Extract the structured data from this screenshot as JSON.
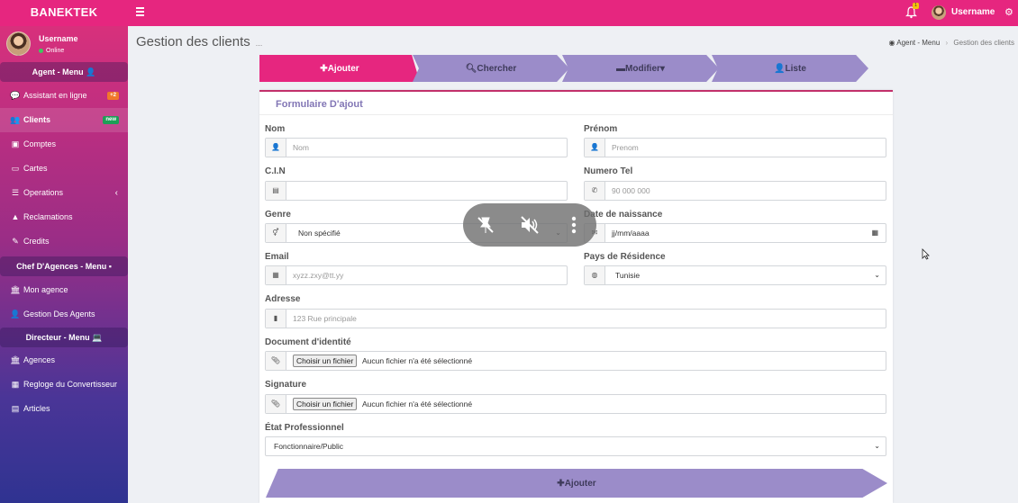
{
  "app": {
    "brand": "BANEKTEK",
    "bell_count": "1",
    "username": "Username"
  },
  "sidebar": {
    "user": {
      "name": "Username",
      "status": "Online"
    },
    "sections": [
      {
        "title": "Agent - Menu",
        "icon": "user-secret-icon"
      },
      {
        "title": "Chef D'Agences - Menu",
        "icon": "briefcase-icon"
      },
      {
        "title": "Directeur - Menu",
        "icon": "laptop-icon"
      }
    ],
    "items": [
      {
        "label": "Assistant en ligne",
        "icon": "comments-icon",
        "badge": "+2"
      },
      {
        "label": "Clients",
        "icon": "users-icon",
        "badge": "new"
      },
      {
        "label": "Comptes",
        "icon": "briefcase-icon"
      },
      {
        "label": "Cartes",
        "icon": "credit-card-icon"
      },
      {
        "label": "Operations",
        "icon": "list-icon"
      },
      {
        "label": "Reclamations",
        "icon": "warning-icon"
      },
      {
        "label": "Credits",
        "icon": "edit-icon"
      },
      {
        "label": "Mon agence",
        "icon": "bank-icon"
      },
      {
        "label": "Gestion Des Agents",
        "icon": "user-icon"
      },
      {
        "label": "Agences",
        "icon": "bank-icon"
      },
      {
        "label": "Regloge du Convertisseur",
        "icon": "calculator-icon"
      },
      {
        "label": "Articles",
        "icon": "newspaper-icon"
      }
    ]
  },
  "header": {
    "title": "Gestion des clients",
    "subtitle": "...",
    "breadcrumb": {
      "home": "Agent - Menu",
      "current": "Gestion des clients"
    }
  },
  "tabs": [
    {
      "label": "Ajouter",
      "icon": "plus-icon"
    },
    {
      "label": "Chercher",
      "icon": "search-icon"
    },
    {
      "label": "Modifier",
      "icon": "briefcase-icon"
    },
    {
      "label": "Liste",
      "icon": "user-icon"
    }
  ],
  "form": {
    "title": "Formulaire D'ajout",
    "nom": {
      "label": "Nom",
      "placeholder": "Nom"
    },
    "prenom": {
      "label": "Prénom",
      "placeholder": "Prenom"
    },
    "cin": {
      "label": "C.I.N",
      "placeholder": ""
    },
    "tel": {
      "label": "Numero Tel",
      "placeholder": "90 000 000"
    },
    "genre": {
      "label": "Genre",
      "value": "Non spécifié"
    },
    "naissance": {
      "label": "Date de naissance",
      "placeholder": "jj/mm/aaaa"
    },
    "email": {
      "label": "Email",
      "placeholder": "xyzz.zxy@tt.yy"
    },
    "pays": {
      "label": "Pays de Résidence",
      "value": "Tunisie"
    },
    "adresse": {
      "label": "Adresse",
      "placeholder": "123 Rue principale"
    },
    "document": {
      "label": "Document d'identité",
      "button": "Choisir un fichier",
      "status": "Aucun fichier n'a été sélectionné"
    },
    "signature": {
      "label": "Signature",
      "button": "Choisir un fichier",
      "status": "Aucun fichier n'a été sélectionné"
    },
    "etat": {
      "label": "État Professionnel",
      "value": "Fonctionnaire/Public"
    },
    "submit": "Ajouter"
  }
}
